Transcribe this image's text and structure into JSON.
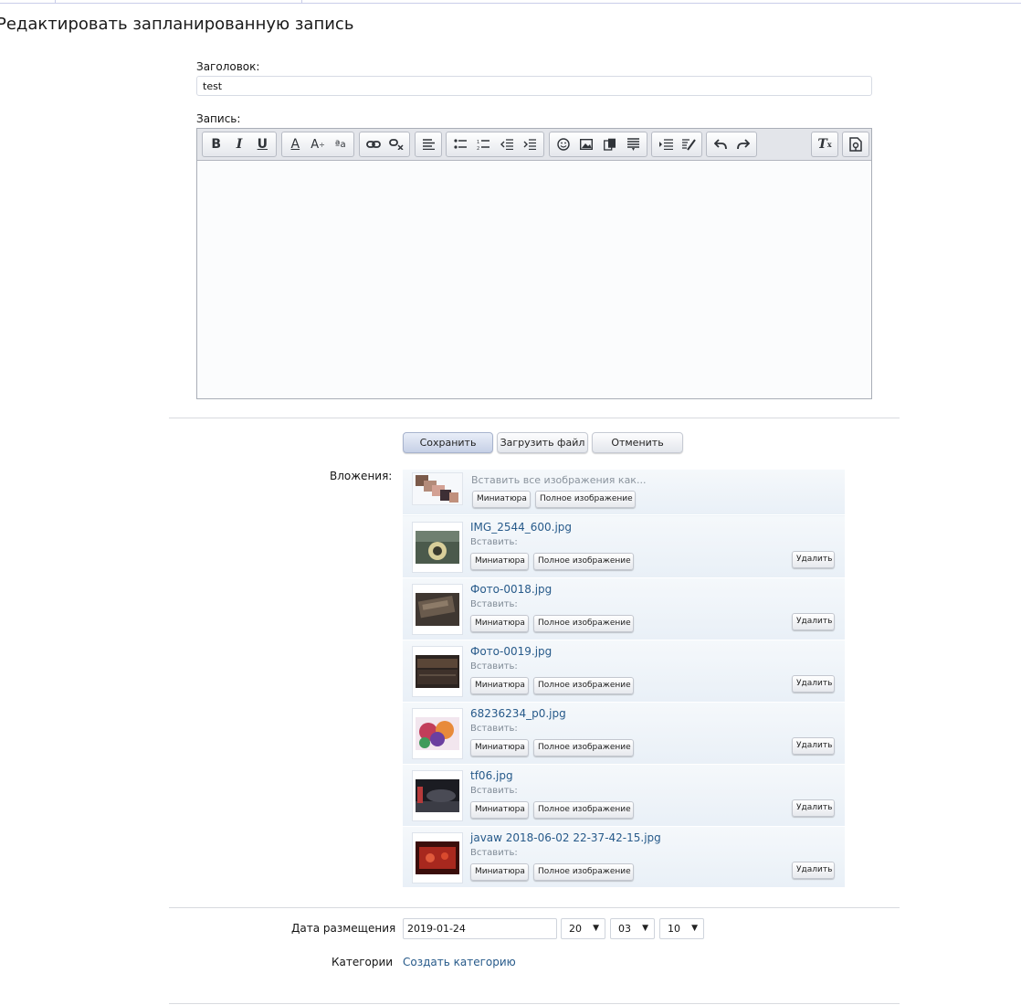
{
  "page_title": "Редактировать запланированную запись",
  "form": {
    "title_label": "Заголовок:",
    "title_value": "test",
    "entry_label": "Запись:"
  },
  "toolbar_icons": [
    "bold-icon",
    "italic-icon",
    "underline-icon",
    "font-color-icon",
    "font-size-icon",
    "font-family-icon",
    "link-icon",
    "unlink-icon",
    "align-icon",
    "bullet-list-icon",
    "numbered-list-icon",
    "outdent-icon",
    "indent-icon",
    "smiley-icon",
    "image-icon",
    "media-icon",
    "quote-icon",
    "code-icon",
    "source-edit-icon",
    "undo-icon",
    "redo-icon",
    "remove-format-icon",
    "draft-icon"
  ],
  "actions": {
    "save": "Сохранить",
    "upload": "Загрузить файл",
    "cancel": "Отменить"
  },
  "attachments": {
    "label": "Вложения:",
    "insert_all": "Вставить все изображения как...",
    "insert_label": "Вставить:",
    "thumb_btn": "Миниатюра",
    "full_btn": "Полное изображение",
    "delete_btn": "Удалить",
    "items": [
      {
        "name": "IMG_2544_600.jpg"
      },
      {
        "name": "Фото-0018.jpg"
      },
      {
        "name": "Фото-0019.jpg"
      },
      {
        "name": "68236234_p0.jpg"
      },
      {
        "name": "tf06.jpg"
      },
      {
        "name": "javaw 2018-06-02 22-37-42-15.jpg"
      }
    ]
  },
  "schedule": {
    "date_label": "Дата размещения",
    "date_value": "2019-01-24",
    "hour": "20",
    "minute": "03",
    "second": "10"
  },
  "categories": {
    "label": "Категории",
    "create_link": "Создать категорию"
  }
}
